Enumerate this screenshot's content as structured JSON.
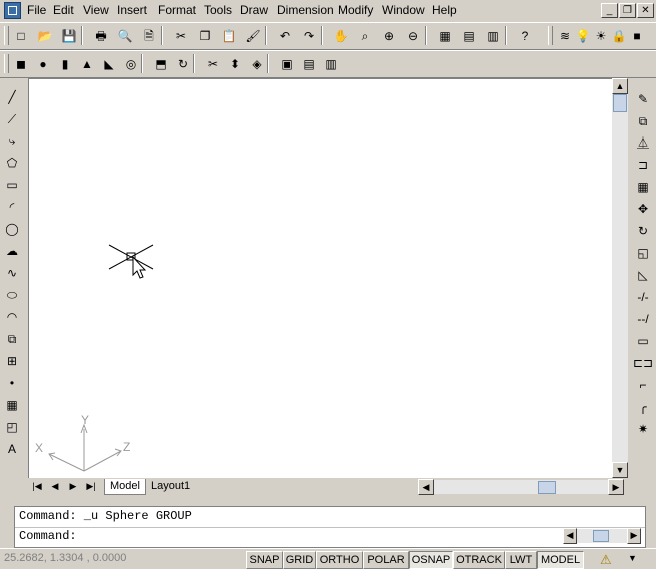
{
  "menubar": {
    "items": [
      "File",
      "Edit",
      "View",
      "Insert",
      "Format",
      "Tools",
      "Draw",
      "Dimension",
      "Modify",
      "Window",
      "Help"
    ],
    "window_controls": [
      "_",
      "❐",
      "✕"
    ]
  },
  "standard_toolbar": {
    "icons": [
      "new-icon",
      "open-icon",
      "save-icon",
      "print-icon",
      "print-preview-icon",
      "publish-icon",
      "cut-icon",
      "copy-icon",
      "paste-icon",
      "match-properties-icon",
      "undo-icon",
      "redo-icon",
      "pan-icon",
      "zoom-realtime-icon",
      "zoom-window-icon",
      "zoom-previous-icon",
      "design-center-icon",
      "properties-icon",
      "tool-palettes-icon",
      "help-icon"
    ],
    "glyphs": [
      "□",
      "📂",
      "💾",
      "🖶",
      "🔍",
      "🗎",
      "✂",
      "❐",
      "📋",
      "🖌",
      "↶",
      "↷",
      "✋",
      "⌕",
      "⊕",
      "⊖",
      "▦",
      "▤",
      "▥",
      "?"
    ]
  },
  "layer_toolbar": {
    "glyphs": [
      "≋",
      "💡",
      "☀",
      "🔒",
      "■"
    ]
  },
  "solids_toolbar": {
    "icons": [
      "box-icon",
      "sphere-icon",
      "cylinder-icon",
      "cone-icon",
      "wedge-icon",
      "torus-icon",
      "extrude-icon",
      "revolve-icon",
      "slice-icon",
      "section-icon",
      "interfere-icon",
      "setup-drawing-icon",
      "setup-view-icon",
      "setup-profile-icon"
    ],
    "glyphs": [
      "◼",
      "●",
      "▮",
      "▲",
      "◣",
      "◎",
      "⬒",
      "↻",
      "✂",
      "⬍",
      "◈",
      "▣",
      "▤",
      "▥"
    ]
  },
  "draw_toolbar": {
    "icons": [
      "line-icon",
      "construction-line-icon",
      "polyline-icon",
      "polygon-icon",
      "rectangle-icon",
      "arc-icon",
      "circle-icon",
      "revision-cloud-icon",
      "spline-icon",
      "ellipse-icon",
      "ellipse-arc-icon",
      "insert-block-icon",
      "make-block-icon",
      "point-icon",
      "hatch-icon",
      "region-icon",
      "text-icon"
    ],
    "glyphs": [
      "╱",
      "⟋",
      "⤷",
      "⬠",
      "▭",
      "◜",
      "◯",
      "☁",
      "∿",
      "⬭",
      "◠",
      "⧉",
      "⊞",
      "•",
      "▦",
      "◰",
      "A"
    ]
  },
  "modify_toolbar": {
    "icons": [
      "erase-icon",
      "copy-object-icon",
      "mirror-icon",
      "offset-icon",
      "array-icon",
      "move-icon",
      "rotate-icon",
      "scale-icon",
      "stretch-icon",
      "trim-icon",
      "extend-icon",
      "break-icon",
      "join-icon",
      "chamfer-icon",
      "fillet-icon",
      "explode-icon"
    ],
    "glyphs": [
      "✎",
      "⧉",
      "⏅",
      "⊐",
      "▦",
      "✥",
      "↻",
      "◱",
      "◺",
      "-/-",
      "--/",
      "▭",
      "⊏⊐",
      "⌐",
      "╭",
      "✷"
    ]
  },
  "canvas": {
    "ucs_labels": {
      "x": "X",
      "y": "Y",
      "z": "Z"
    }
  },
  "layout_tabs": {
    "nav": [
      "|◀",
      "◀",
      "▶",
      "▶|"
    ],
    "tabs": [
      "Model",
      "Layout1"
    ],
    "active": "Model"
  },
  "command_window": {
    "history": "Command: _u Sphere GROUP",
    "prompt": "Command:",
    "input_value": ""
  },
  "statusbar": {
    "coordinates": "25.2682, 1.3304 , 0.0000",
    "buttons": [
      {
        "label": "SNAP",
        "pressed": false
      },
      {
        "label": "GRID",
        "pressed": false
      },
      {
        "label": "ORTHO",
        "pressed": false
      },
      {
        "label": "POLAR",
        "pressed": false
      },
      {
        "label": "OSNAP",
        "pressed": true
      },
      {
        "label": "OTRACK",
        "pressed": false
      },
      {
        "label": "LWT",
        "pressed": false
      },
      {
        "label": "MODEL",
        "pressed": true
      }
    ]
  },
  "colors": {
    "chrome": "#d4d0c8",
    "canvas": "#ffffff",
    "accent_blue": "#2b5fb3",
    "ucs_gray": "#9a9a9a"
  }
}
